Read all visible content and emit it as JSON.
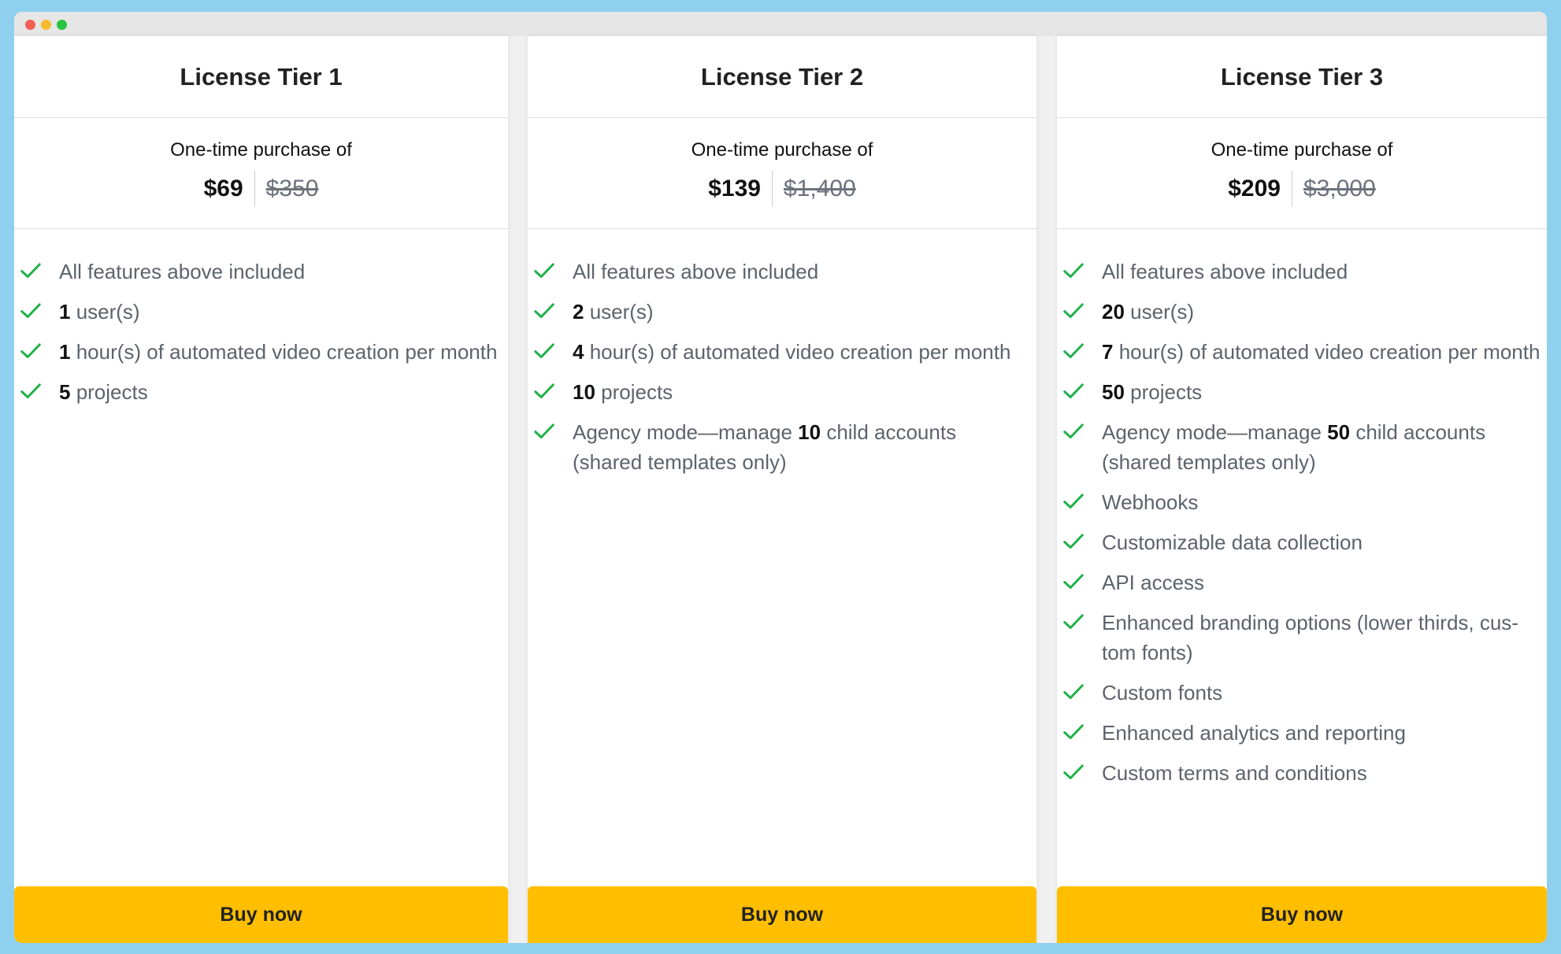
{
  "tiers": [
    {
      "title": "License Tier 1",
      "price_caption": "One-time purchase of",
      "price": "$69",
      "original_price": "$350",
      "features": [
        {
          "pre": "",
          "bold": "",
          "post": "All features above included"
        },
        {
          "pre": "",
          "bold": "1",
          "post": " user(s)"
        },
        {
          "pre": "",
          "bold": "1",
          "post": " hour(s) of automated video creation per month"
        },
        {
          "pre": "",
          "bold": "5",
          "post": " projects"
        }
      ],
      "button": "Buy now"
    },
    {
      "title": "License Tier 2",
      "price_caption": "One-time purchase of",
      "price": "$139",
      "original_price": "$1,400",
      "features": [
        {
          "pre": "",
          "bold": "",
          "post": "All features above included"
        },
        {
          "pre": "",
          "bold": "2",
          "post": " user(s)"
        },
        {
          "pre": "",
          "bold": "4",
          "post": " hour(s) of automated video creation per month"
        },
        {
          "pre": "",
          "bold": "10",
          "post": " projects"
        },
        {
          "pre": "Agency mode—manage ",
          "bold": "10",
          "post": " child accounts (shared templates only)"
        }
      ],
      "button": "Buy now"
    },
    {
      "title": "License Tier 3",
      "price_caption": "One-time purchase of",
      "price": "$209",
      "original_price": "$3,000",
      "features": [
        {
          "pre": "",
          "bold": "",
          "post": "All features above included"
        },
        {
          "pre": "",
          "bold": "20",
          "post": " user(s)"
        },
        {
          "pre": "",
          "bold": "7",
          "post": " hour(s) of automated video creation per month"
        },
        {
          "pre": "",
          "bold": "50",
          "post": " projects"
        },
        {
          "pre": "Agency mode—manage ",
          "bold": "50",
          "post": " child accounts (shared templates only)"
        },
        {
          "pre": "",
          "bold": "",
          "post": "Webhooks"
        },
        {
          "pre": "",
          "bold": "",
          "post": "Customizable data collection"
        },
        {
          "pre": "",
          "bold": "",
          "post": "API access"
        },
        {
          "pre": "",
          "bold": "",
          "post": "Enhanced branding options (lower thirds, cus-tom fonts)"
        },
        {
          "pre": "",
          "bold": "",
          "post": "Custom fonts"
        },
        {
          "pre": "",
          "bold": "",
          "post": "Enhanced analytics and reporting"
        },
        {
          "pre": "",
          "bold": "",
          "post": "Custom terms and conditions"
        }
      ],
      "button": "Buy now"
    }
  ],
  "icon": "checkmark-icon",
  "colors": {
    "accent": "#ffbf00",
    "check": "#1fb14a",
    "background": "#8fd0ee"
  }
}
